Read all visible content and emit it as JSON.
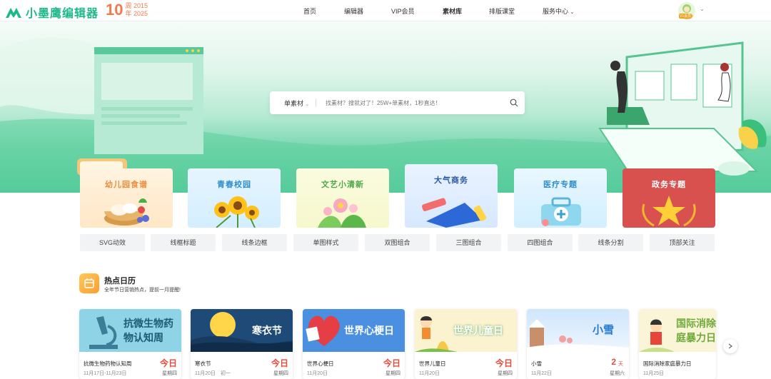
{
  "header": {
    "logo_name": "小墨鹰编辑器",
    "anniv_num": "10",
    "anniv_line1": "周 2015",
    "anniv_line2": "年 2025",
    "nav": [
      "首页",
      "编辑器",
      "VIP会员",
      "素材库",
      "排版课堂",
      "服务中心"
    ],
    "avatar_badge": "V1会员"
  },
  "search": {
    "type_label": "单素材",
    "placeholder": "找素材？搜就对了！25W+单素材，1秒直达！"
  },
  "categories": [
    {
      "label": "幼儿园食谱",
      "color": "#f08c3a",
      "icon": "food-bowl-icon"
    },
    {
      "label": "青春校园",
      "color": "#2f8fd0",
      "icon": "sunflower-icon"
    },
    {
      "label": "文艺小清新",
      "color": "#4ca84a",
      "icon": "flower-icon"
    },
    {
      "label": "大气商务",
      "color": "#2d5aa8",
      "icon": "briefcase-icon"
    },
    {
      "label": "医疗专题",
      "color": "#2f8fd0",
      "icon": "medical-kit-icon"
    },
    {
      "label": "政务专题",
      "color": "#ffffff",
      "icon": "star-emblem-icon"
    }
  ],
  "tags": [
    "SVG动效",
    "线框标题",
    "线条边框",
    "单图样式",
    "双图组合",
    "三图组合",
    "四图组合",
    "线条分割",
    "顶部关注"
  ],
  "hot": {
    "title": "热点日历",
    "subtitle": "全年节日营销热点，提前一月提醒!"
  },
  "cards": [
    {
      "banner": "抗微生物药物认知周",
      "name": "抗微生物药物认知周",
      "date": "11月17日-11月23日",
      "badge": "今日",
      "week": "星期四"
    },
    {
      "banner": "寒衣节",
      "name": "寒衣节",
      "date": "11月20日　初一",
      "badge": "今日",
      "week": "星期四"
    },
    {
      "banner": "世界心梗日",
      "name": "世界心梗日",
      "date": "11月20日",
      "badge": "今日",
      "week": "星期四"
    },
    {
      "banner": "世界儿童日",
      "name": "世界儿童日",
      "date": "11月20日",
      "badge": "今日",
      "week": "星期四"
    },
    {
      "banner": "小雪",
      "name": "小雪",
      "date": "11月22日",
      "badge": "2",
      "badge_unit": "天",
      "week": "星期六"
    },
    {
      "banner": "国际消除家庭暴力日",
      "name": "国际消除家庭暴力日",
      "date": "11月25日",
      "badge": "",
      "week": ""
    }
  ],
  "colors": {
    "brand": "#1fb88a",
    "accent": "#e84b3c"
  }
}
